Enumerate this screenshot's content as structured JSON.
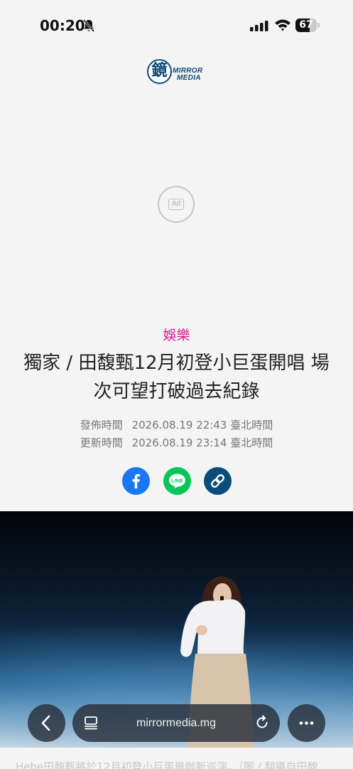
{
  "status_bar": {
    "time": "00:20",
    "battery_level": "67",
    "battery_fraction": 0.67
  },
  "brand": {
    "logo_glyph": "鏡",
    "logo_line1": "MIRROR",
    "logo_line2": "MEDIA",
    "color": "#0c4b79"
  },
  "ad": {
    "label": "Ad"
  },
  "article": {
    "category": "娛樂",
    "category_color": "#d81b8b",
    "title": "獨家 / 田馥甄12月初登小巨蛋開唱 場次可望打破過去紀錄",
    "published_label": "發佈時間",
    "published_time": "2026.08.19 22:43 臺北時間",
    "updated_label": "更新時間",
    "updated_time": "2026.08.19 23:14 臺北時間",
    "caption": "Hebe田馥甄將於12月初登小巨蛋舉辦新巡演。（圖 / 翻攝自田馥"
  },
  "share": {
    "facebook_icon": "facebook-icon",
    "line_label": "LINE",
    "link_icon": "link-icon"
  },
  "browser": {
    "url": "mirrormedia.mg",
    "back_icon": "chevron-left-icon",
    "tabs_icon": "tabs-icon",
    "reload_icon": "reload-icon",
    "more_icon": "ellipsis-icon"
  }
}
